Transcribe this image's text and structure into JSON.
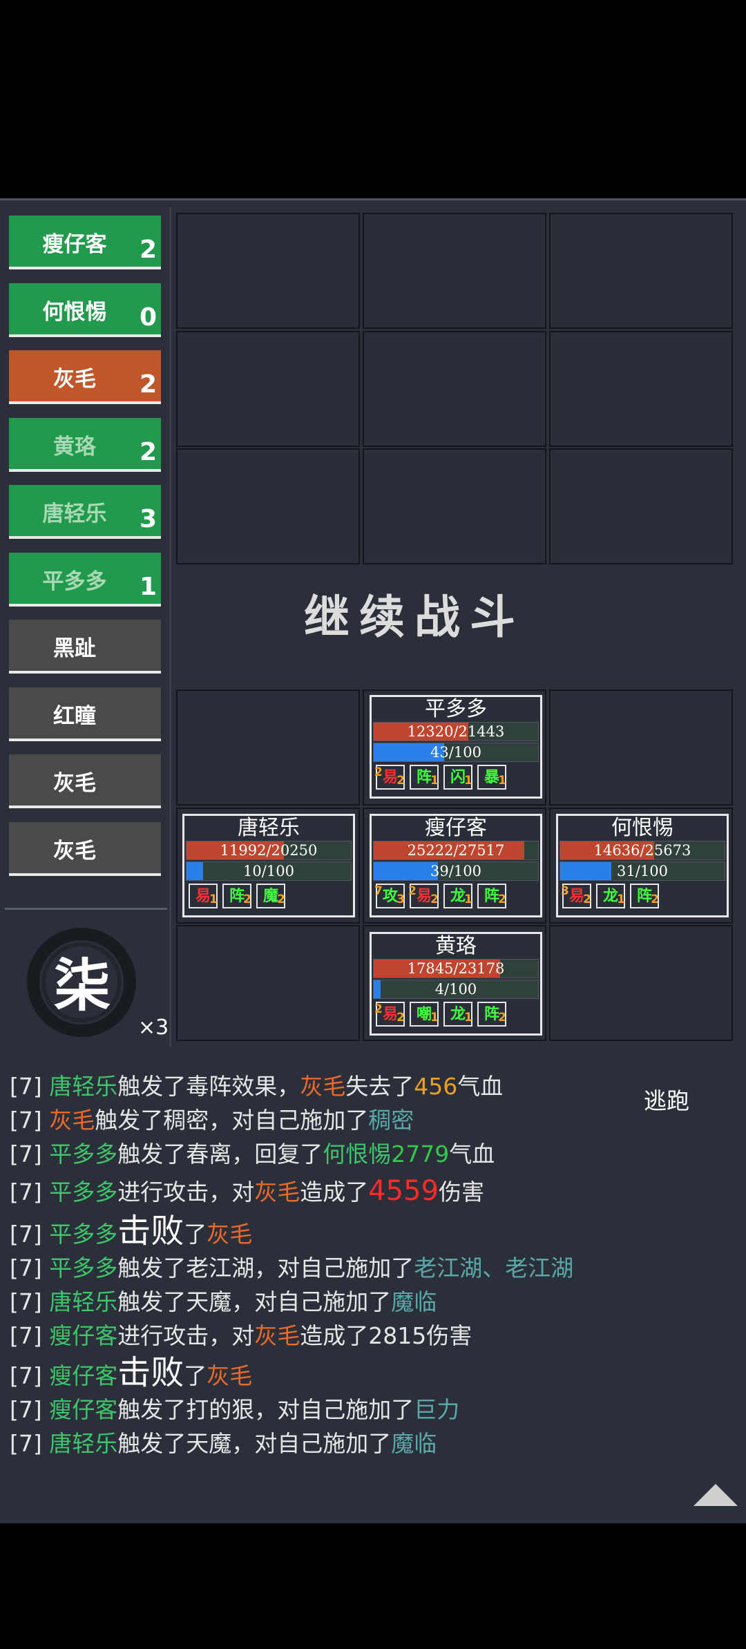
{
  "turn_order": [
    {
      "name": "瘦仔客",
      "count": "2",
      "color": "green"
    },
    {
      "name": "何恨惕",
      "count": "0",
      "color": "green"
    },
    {
      "name": "灰毛",
      "count": "2",
      "color": "orange"
    },
    {
      "name": "黄珞",
      "count": "2",
      "color": "green-dim"
    },
    {
      "name": "唐轻乐",
      "count": "3",
      "color": "green-dim"
    },
    {
      "name": "平多多",
      "count": "1",
      "color": "green-dim"
    },
    {
      "name": "黑趾",
      "count": "",
      "color": "gray"
    },
    {
      "name": "红瞳",
      "count": "",
      "color": "gray"
    },
    {
      "name": "灰毛",
      "count": "",
      "color": "gray"
    },
    {
      "name": "灰毛",
      "count": "",
      "color": "gray"
    }
  ],
  "round": {
    "number": "柒",
    "multiplier": "×3"
  },
  "continue_label": "继续战斗",
  "flee_label": "逃跑",
  "units": {
    "top": {
      "name": "平多多",
      "hp": "12320/21443",
      "hp_frac": 0.575,
      "mp": "43/100",
      "mp_frac": 0.43,
      "skills": [
        {
          "pre": "2",
          "t": "易",
          "lvl": "2",
          "c": "#ff3030"
        },
        {
          "t": "阵",
          "lvl": "1",
          "c": "#40ff40"
        },
        {
          "t": "闪",
          "lvl": "1",
          "c": "#40ff40"
        },
        {
          "t": "暴",
          "lvl": "1",
          "c": "#40ff40"
        }
      ]
    },
    "left": {
      "name": "唐轻乐",
      "hp": "11992/20250",
      "hp_frac": 0.592,
      "mp": "10/100",
      "mp_frac": 0.1,
      "skills": [
        {
          "t": "易",
          "lvl": "1",
          "c": "#ff3030"
        },
        {
          "t": "阵",
          "lvl": "2",
          "c": "#40ff40"
        },
        {
          "t": "魔",
          "lvl": "2",
          "c": "#40ff40"
        }
      ]
    },
    "center": {
      "name": "瘦仔客",
      "hp": "25222/27517",
      "hp_frac": 0.917,
      "mp": "39/100",
      "mp_frac": 0.39,
      "skills": [
        {
          "pre": "7",
          "t": "攻",
          "lvl": "3",
          "c": "#40ff40"
        },
        {
          "pre": "2",
          "t": "易",
          "lvl": "2",
          "c": "#ff3030"
        },
        {
          "t": "龙",
          "lvl": "1",
          "c": "#40ff40"
        },
        {
          "t": "阵",
          "lvl": "2",
          "c": "#40ff40"
        }
      ]
    },
    "right": {
      "name": "何恨惕",
      "hp": "14636/25673",
      "hp_frac": 0.57,
      "mp": "31/100",
      "mp_frac": 0.31,
      "skills": [
        {
          "pre": "3",
          "t": "易",
          "lvl": "2",
          "c": "#ff3030"
        },
        {
          "t": "龙",
          "lvl": "1",
          "c": "#40ff40"
        },
        {
          "t": "阵",
          "lvl": "2",
          "c": "#40ff40"
        }
      ]
    },
    "bottom": {
      "name": "黄珞",
      "hp": "17845/23178",
      "hp_frac": 0.77,
      "mp": "4/100",
      "mp_frac": 0.04,
      "skills": [
        {
          "pre": "2",
          "t": "易",
          "lvl": "2",
          "c": "#ff3030"
        },
        {
          "t": "嘲",
          "lvl": "1",
          "c": "#40ff40"
        },
        {
          "t": "龙",
          "lvl": "1",
          "c": "#40ff40"
        },
        {
          "t": "阵",
          "lvl": "2",
          "c": "#40ff40"
        }
      ]
    }
  },
  "log": [
    {
      "big": false,
      "parts": [
        [
          "[7] ",
          ""
        ],
        [
          "唐轻乐",
          "g"
        ],
        [
          "触发了毒阵效果，",
          ""
        ],
        [
          "灰毛",
          "o"
        ],
        [
          "失去了",
          ""
        ],
        [
          "456",
          "n"
        ],
        [
          "气血",
          ""
        ]
      ]
    },
    {
      "big": false,
      "parts": [
        [
          "[7] ",
          ""
        ],
        [
          "灰毛",
          "o"
        ],
        [
          "触发了稠密，对自己施加了",
          ""
        ],
        [
          "稠密",
          "t"
        ]
      ]
    },
    {
      "big": false,
      "parts": [
        [
          "[7] ",
          ""
        ],
        [
          "平多多",
          "g"
        ],
        [
          "触发了春离，回复了",
          ""
        ],
        [
          "何恨惕",
          "g"
        ],
        [
          "2779",
          "gn"
        ],
        [
          "气血",
          ""
        ]
      ]
    },
    {
      "big": true,
      "parts": [
        [
          "[7] ",
          ""
        ],
        [
          "平多多",
          "g"
        ],
        [
          "进行攻击，对",
          ""
        ],
        [
          "灰毛",
          "o"
        ],
        [
          "造成了",
          ""
        ],
        [
          "4559",
          "r"
        ],
        [
          "伤害",
          ""
        ]
      ]
    },
    {
      "big": true,
      "parts": [
        [
          "[7] ",
          ""
        ],
        [
          "平多多",
          "g"
        ],
        [
          "击败",
          "kb"
        ],
        [
          "了",
          ""
        ],
        [
          "灰毛",
          "o"
        ]
      ]
    },
    {
      "big": false,
      "parts": [
        [
          "[7] ",
          ""
        ],
        [
          "平多多",
          "g"
        ],
        [
          "触发了老江湖，对自己施加了",
          ""
        ],
        [
          "老江湖、老江湖",
          "t"
        ]
      ]
    },
    {
      "big": false,
      "parts": [
        [
          "[7] ",
          ""
        ],
        [
          "唐轻乐",
          "g"
        ],
        [
          "触发了天魔，对自己施加了",
          ""
        ],
        [
          "魔临",
          "t"
        ]
      ]
    },
    {
      "big": false,
      "parts": [
        [
          "[7] ",
          ""
        ],
        [
          "瘦仔客",
          "g"
        ],
        [
          "进行攻击，对",
          ""
        ],
        [
          "灰毛",
          "o"
        ],
        [
          "造成了2815伤害",
          ""
        ]
      ]
    },
    {
      "big": true,
      "parts": [
        [
          "[7] ",
          ""
        ],
        [
          "瘦仔客",
          "g"
        ],
        [
          "击败",
          "kb"
        ],
        [
          "了",
          ""
        ],
        [
          "灰毛",
          "o"
        ]
      ]
    },
    {
      "big": false,
      "parts": [
        [
          "[7] ",
          ""
        ],
        [
          "瘦仔客",
          "g"
        ],
        [
          "触发了打的狠，对自己施加了",
          ""
        ],
        [
          "巨力",
          "t"
        ]
      ]
    },
    {
      "big": false,
      "parts": [
        [
          "[7] ",
          ""
        ],
        [
          "唐轻乐",
          "g"
        ],
        [
          "触发了天魔，对自己施加了",
          ""
        ],
        [
          "魔临",
          "t"
        ]
      ]
    }
  ]
}
